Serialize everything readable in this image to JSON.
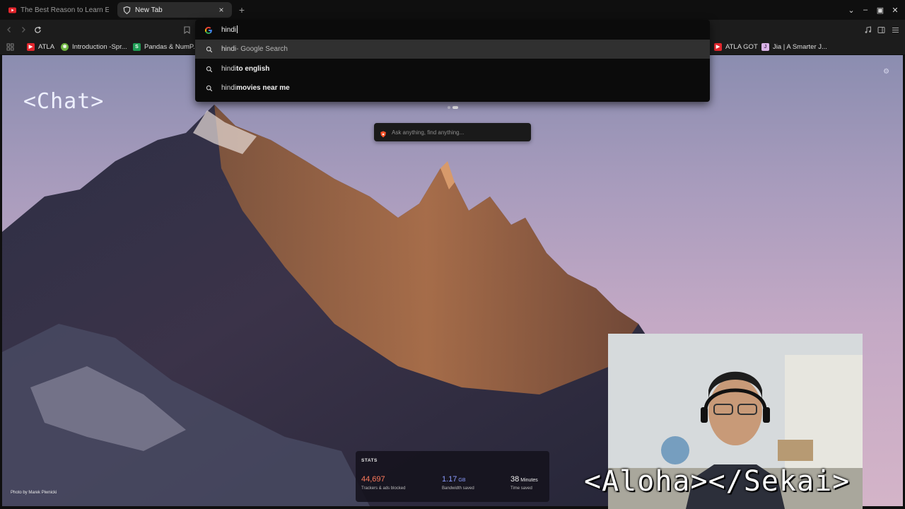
{
  "tabs": [
    {
      "title": "The Best Reason to Learn Each",
      "favicon": "youtube-icon",
      "active": false
    },
    {
      "title": "New Tab",
      "favicon": "brave-shield-icon",
      "active": true
    }
  ],
  "tab_close_glyph": "×",
  "new_tab_glyph": "+",
  "window_controls": {
    "dropdown": "⌄",
    "minimize": "–",
    "maximize": "▣",
    "close": "✕"
  },
  "address_bar": {
    "value": "hindi",
    "engine_icon": "google-g-icon"
  },
  "suggestions": [
    {
      "match": "hindi",
      "rest": " - Google Search",
      "rest_bold": false,
      "selected": true
    },
    {
      "match": "hindi",
      "rest": " to english",
      "rest_bold": true,
      "selected": false
    },
    {
      "match": "hindi",
      "rest": " movies near me",
      "rest_bold": true,
      "selected": false
    }
  ],
  "bookmarks_left": [
    {
      "label": "ATLA",
      "icon": "youtube-icon",
      "color": "#e3262d",
      "glyph": "▶"
    },
    {
      "label": "Introduction -Spr...",
      "icon": "spring-leaf-icon",
      "color": "#6db33f",
      "glyph": "❀"
    },
    {
      "label": "Pandas & NumP...",
      "icon": "sheets-icon",
      "color": "#1f9d55",
      "glyph": "S"
    }
  ],
  "bookmarks_right": [
    {
      "label": "ATLA GOT",
      "icon": "youtube-icon",
      "color": "#e3262d",
      "glyph": "▶"
    },
    {
      "label": "Jia | A Smarter J...",
      "icon": "jia-icon",
      "color": "#d9b3e6",
      "glyph": "J"
    }
  ],
  "overlays": {
    "chat": "<Chat>",
    "aloha": "<Aloha></Sekai>"
  },
  "search_box": {
    "placeholder": "Ask anything, find anything..."
  },
  "photo_credit": "Photo by Marek Piwnicki",
  "stats": {
    "title": "STATS",
    "items": [
      {
        "value": "44,697",
        "unit": "",
        "caption": "Trackers & ads blocked",
        "color": "#ff7a5c"
      },
      {
        "value": "1.17",
        "unit": "GB",
        "caption": "Bandwidth saved",
        "color": "#8b9cff"
      },
      {
        "value": "38",
        "unit": "Minutes",
        "caption": "Time saved",
        "color": "#ffffff"
      }
    ]
  },
  "colors": {
    "accent_orange": "#ff7a5c",
    "accent_blue": "#8b9cff",
    "brave_orange": "#fb542b"
  }
}
